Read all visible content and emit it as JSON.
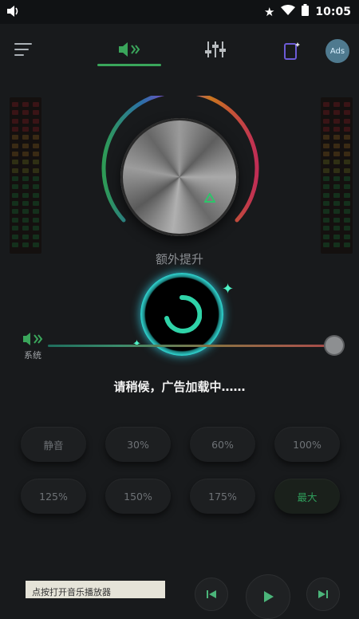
{
  "status_bar": {
    "time": "10:05",
    "icons": [
      "volume-icon",
      "star-icon",
      "wifi-icon",
      "battery-icon"
    ]
  },
  "top_bar": {
    "tabs": [
      {
        "name": "volume-booster-tab",
        "icon": "speaker-icon",
        "active": true
      },
      {
        "name": "equalizer-tab",
        "icon": "equalizer-icon",
        "active": false
      }
    ],
    "ads_label": "Ads"
  },
  "knob": {
    "title": "额外提升"
  },
  "system_slider": {
    "label": "系统",
    "value_fraction": 0.97
  },
  "loading_text": "请稍候，广告加载中……",
  "presets": [
    [
      "静音",
      "30%",
      "60%",
      "100%"
    ],
    [
      "125%",
      "150%",
      "175%",
      "最大"
    ]
  ],
  "bottom": {
    "ad_text": "点按打开音乐播放器"
  },
  "colors": {
    "accent_green": "#3aa65b",
    "teal": "#2fd3cf"
  }
}
